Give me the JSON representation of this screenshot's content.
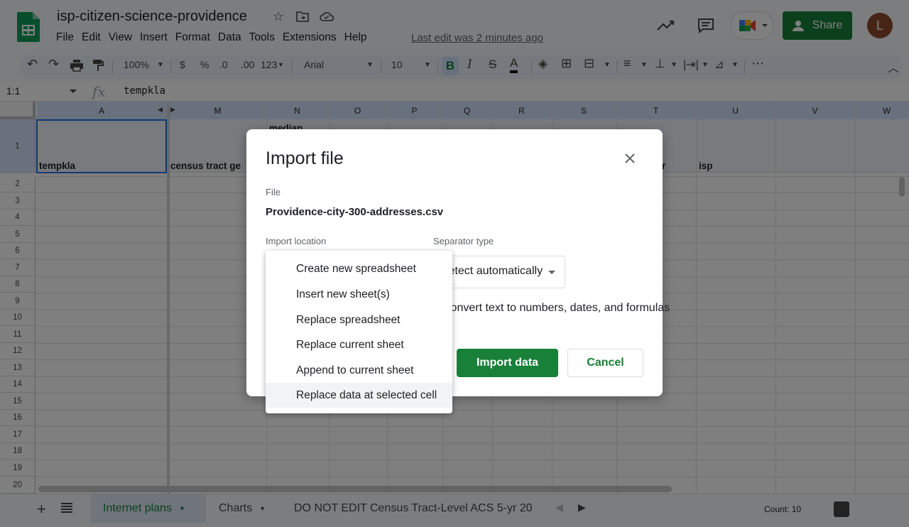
{
  "app": {
    "doc_title": "isp-citizen-science-providence",
    "menu": [
      "File",
      "Edit",
      "View",
      "Insert",
      "Format",
      "Data",
      "Tools",
      "Extensions",
      "Help"
    ],
    "last_edit": "Last edit was 2 minutes ago",
    "share_label": "Share",
    "avatar_initial": "L"
  },
  "toolbar": {
    "zoom": "100%",
    "currency": "$",
    "percent": "%",
    "dec_decrease": ".0",
    "dec_increase": ".00",
    "number_format": "123",
    "font": "Arial",
    "font_size": "10",
    "bold": "B",
    "italic": "I",
    "strike": "S",
    "text_color": "A",
    "more": "⋯"
  },
  "formula_bar": {
    "name_box": "1:1",
    "fx": "fx",
    "value": "tempkla"
  },
  "grid": {
    "columns": [
      "A",
      "M",
      "N",
      "O",
      "P",
      "Q",
      "R",
      "S",
      "T",
      "U",
      "V",
      "W"
    ],
    "rows": [
      "1",
      "2",
      "3",
      "4",
      "5",
      "6",
      "7",
      "8",
      "9",
      "10",
      "11",
      "12",
      "13",
      "14",
      "15",
      "16",
      "17",
      "18",
      "19",
      "20"
    ],
    "header_cells": {
      "A": "tempkla",
      "M": "census tract ge",
      "N": "median",
      "T": "r",
      "U": "isp"
    }
  },
  "sheets": {
    "tabs": [
      "Internet plans",
      "Charts",
      "DO NOT EDIT Census Tract-Level ACS 5-yr 20"
    ],
    "count": "Count: 10"
  },
  "dialog": {
    "title": "Import file",
    "file_label": "File",
    "file_name": "Providence-city-300-addresses.csv",
    "import_location_label": "Import location",
    "separator_label": "Separator type",
    "separator_value": "Detect automatically",
    "convert_text": "Convert text to numbers, dates, and formulas",
    "import_button": "Import data",
    "cancel_button": "Cancel"
  },
  "import_location_menu": {
    "options": [
      "Create new spreadsheet",
      "Insert new sheet(s)",
      "Replace spreadsheet",
      "Replace current sheet",
      "Append to current sheet",
      "Replace data at selected cell"
    ],
    "highlighted": "Replace data at selected cell"
  },
  "colors": {
    "accent_green": "#188038",
    "selection_blue": "#1a73e8"
  }
}
